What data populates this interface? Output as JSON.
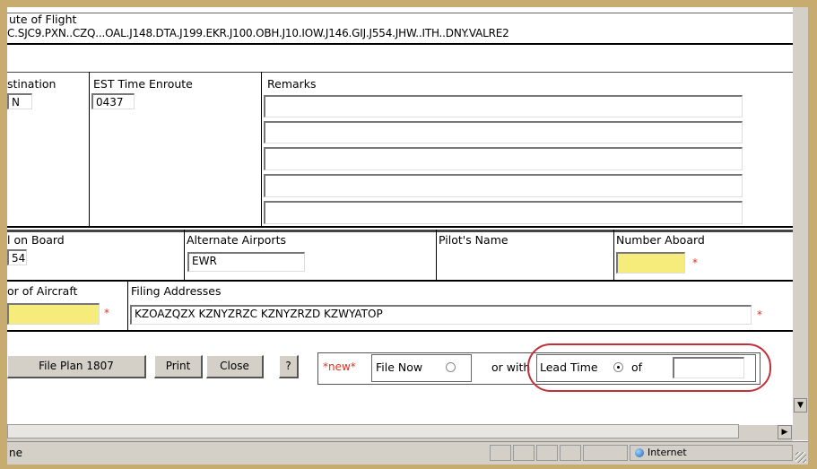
{
  "route": {
    "label": "ute of Flight",
    "value": "C.SJC9.PXN..CZQ...OAL.J148.DTA.J199.EKR.J100.OBH.J10.IOW.J146.GIJ.J554.JHW..ITH..DNY.VALRE2"
  },
  "destination": {
    "label": "stination",
    "value": "N"
  },
  "est_time_enroute": {
    "label": "EST Time Enroute",
    "value": "0437"
  },
  "remarks": {
    "label": "Remarks",
    "lines": [
      "",
      "",
      "",
      "",
      ""
    ]
  },
  "fuel_on_board": {
    "label": "l on Board",
    "value": "54"
  },
  "alternate_airports": {
    "label": "Alternate Airports",
    "value": "EWR"
  },
  "pilots_name": {
    "label": "Pilot's Name"
  },
  "number_aboard": {
    "label": "Number Aboard",
    "value": ""
  },
  "color_of_aircraft": {
    "label": "or of Aircraft",
    "value": ""
  },
  "filing_addresses": {
    "label": "Filing Addresses",
    "value": "KZOAZQZX KZNYZRZC KZNYZRZD KZWYATOP"
  },
  "required_marker": "*",
  "buttons": {
    "file_plan": "File Plan 1807",
    "print": "Print",
    "close": "Close",
    "help": "?"
  },
  "filing_options": {
    "new_tag": "*new*",
    "file_now": "File Now",
    "or_with": "or with",
    "lead_time": "Lead Time",
    "of": "of",
    "lead_time_value": "",
    "selected": "lead_time"
  },
  "status_bar": {
    "text": "ne",
    "zone": "Internet"
  },
  "colors": {
    "highlight_circle": "#c0303a",
    "required": "#e0331d",
    "field_yellow": "#f5ec7c"
  }
}
